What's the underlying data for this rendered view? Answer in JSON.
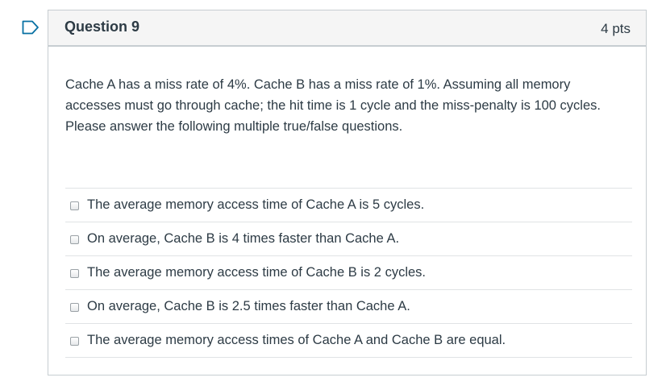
{
  "question": {
    "title": "Question 9",
    "points": "4 pts",
    "text": "Cache A has a miss rate of 4%. Cache B has a miss rate of 1%. Assuming all memory accesses must go through cache; the hit time is 1 cycle and the miss-penalty is 100 cycles. Please answer the following multiple true/false questions.",
    "answers": [
      {
        "label": "The average memory access time of Cache A is 5 cycles."
      },
      {
        "label": "On average, Cache B is 4 times faster than Cache A."
      },
      {
        "label": "The average memory access time of Cache B is 2 cycles."
      },
      {
        "label": "On average, Cache B is 2.5 times faster than Cache A."
      },
      {
        "label": "The average memory access times of Cache A and Cache B are equal."
      }
    ]
  },
  "flag_icon": "flag-question-icon",
  "colors": {
    "accent": "#0770a3",
    "text": "#2d3b45",
    "border": "#c7cdd1",
    "header_bg": "#f5f5f5"
  }
}
